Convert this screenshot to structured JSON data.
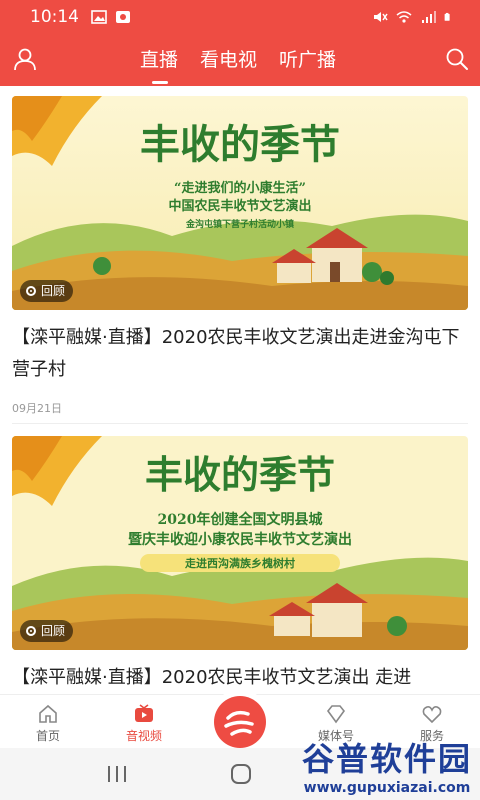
{
  "status_bar": {
    "time": "10:14"
  },
  "header": {
    "tabs": [
      {
        "label": "直播",
        "active": true
      },
      {
        "label": "看电视",
        "active": false
      },
      {
        "label": "听广播",
        "active": false
      }
    ]
  },
  "feed": [
    {
      "badge": "回顾",
      "title": "【滦平融媒·直播】2020农民丰收文艺演出走进金沟屯下营子村",
      "date": "09月21日",
      "banner_big": "丰收的季节",
      "banner_line1": "“走进我们的小康生活”",
      "banner_line2": "中国农民丰收节文艺演出",
      "banner_line3": "金沟屯镇下营子村活动小镇"
    },
    {
      "badge": "回顾",
      "title": "【滦平融媒·直播】2020农民丰收节文艺演出 走进",
      "date": "",
      "banner_big": "丰收的季节",
      "banner_line1": "2020年创建全国文明县城",
      "banner_line2": "暨庆丰收迎小康农民丰收节文艺演出",
      "banner_line3": "走进西沟满族乡槐树村"
    }
  ],
  "bottom_nav": [
    {
      "label": "首页",
      "active": false
    },
    {
      "label": "音视频",
      "active": true
    },
    {
      "label": "",
      "active": false
    },
    {
      "label": "媒体号",
      "active": false
    },
    {
      "label": "服务",
      "active": false
    }
  ],
  "watermark": {
    "big": "谷普软件园",
    "small": "www.gupuxiazai.com"
  },
  "colors": {
    "accent": "#ee4c43",
    "nav_active": "#e84a3f"
  }
}
